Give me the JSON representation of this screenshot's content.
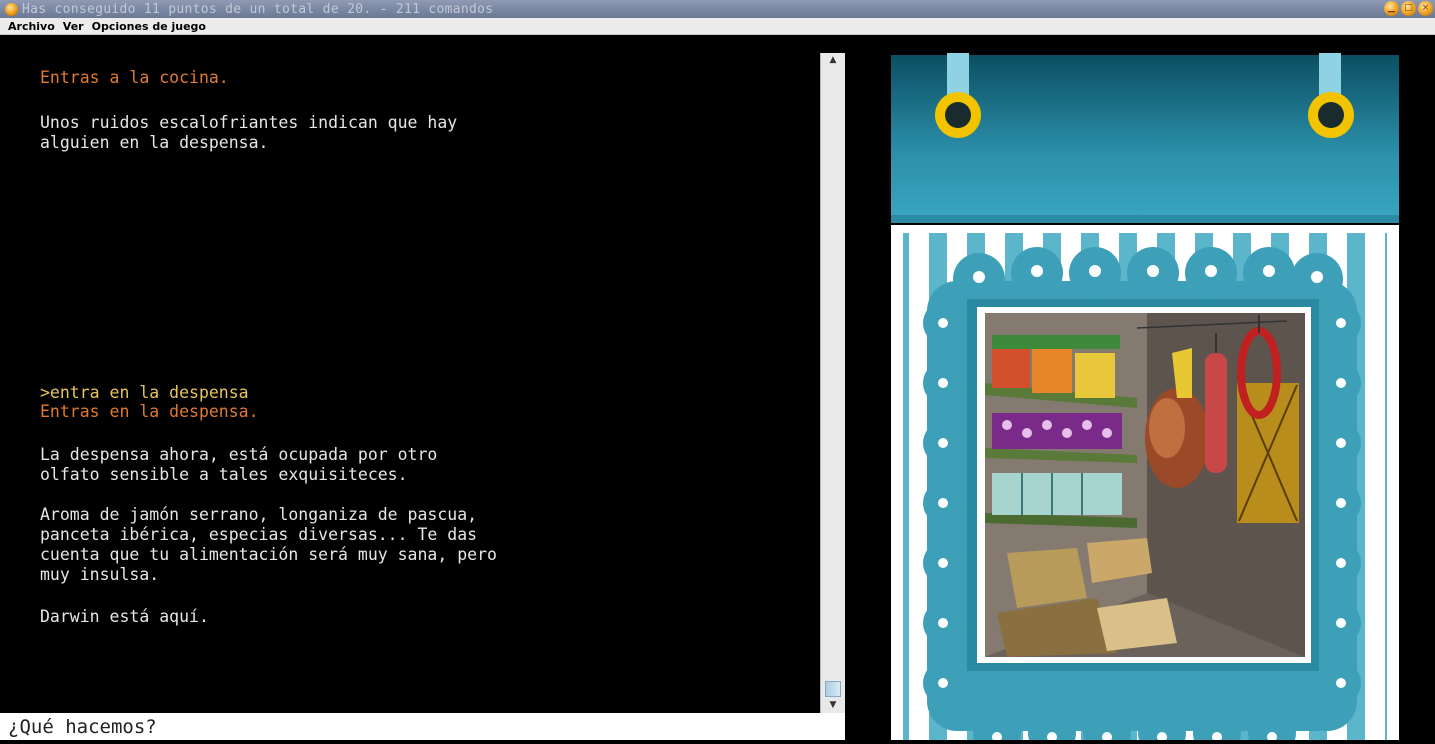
{
  "window": {
    "title": "Has conseguido 11 puntos de un total de 20. - 211 comandos"
  },
  "menu": {
    "items": [
      "Archivo",
      "Ver",
      "Opciones de juego"
    ]
  },
  "game": {
    "lines": [
      {
        "text": "Entras a la cocina.",
        "color": "orange"
      },
      {
        "text": "Unos ruidos escalofriantes indican que hay",
        "color": "white"
      },
      {
        "text": "alguien en la despensa.",
        "color": "white"
      },
      {
        "text": ">entra en la despensa",
        "color": "yellow"
      },
      {
        "text": "Entras en la despensa.",
        "color": "orange"
      },
      {
        "text": "La despensa ahora, está ocupada por otro",
        "color": "white"
      },
      {
        "text": "olfato sensible a tales exquisiteces.",
        "color": "white"
      },
      {
        "text": "Aroma de jamón serrano, longaniza de pascua,",
        "color": "white"
      },
      {
        "text": "panceta ibérica, especias diversas... Te das",
        "color": "white"
      },
      {
        "text": "cuenta que tu alimentación será muy sana, pero",
        "color": "white"
      },
      {
        "text": "muy insulsa.",
        "color": "white"
      },
      {
        "text": "Darwin está aquí.",
        "color": "white"
      }
    ]
  },
  "input": {
    "prompt": "¿Qué hacemos?"
  },
  "colors": {
    "orange": "#e07a2e",
    "yellow": "#e6c55a",
    "white": "#e6e6e6",
    "teal": "#3d9fb8",
    "dark_teal": "#0e5a6e"
  },
  "icons": [
    "app-icon",
    "minimize-icon",
    "maximize-icon",
    "close-icon",
    "scroll-up-icon",
    "scroll-down-icon"
  ]
}
